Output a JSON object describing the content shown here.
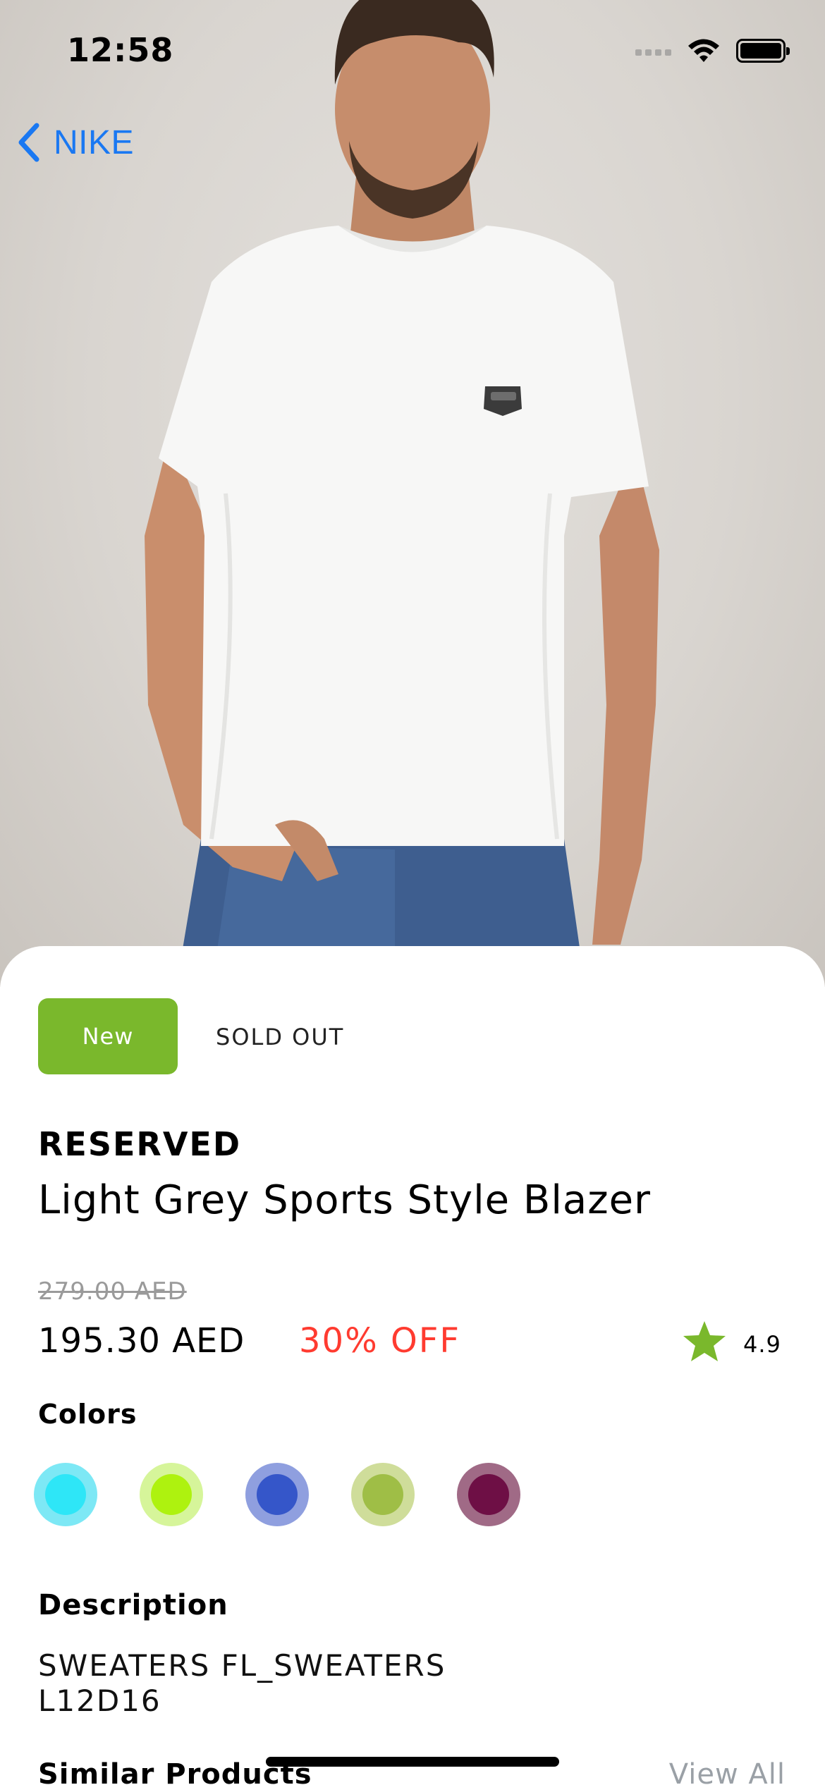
{
  "status_bar": {
    "time": "12:58"
  },
  "nav": {
    "back_label": "NIKE"
  },
  "product": {
    "badge": "New",
    "availability": "SOLD OUT",
    "brand": "RESERVED",
    "title": "Light Grey Sports Style Blazer",
    "original_price": "279.00 AED",
    "price": "195.30 AED",
    "discount": "30% OFF",
    "rating": "4.9"
  },
  "colors": {
    "label": "Colors",
    "swatches": [
      {
        "name": "cyan",
        "ring": "#7de8f5",
        "fill": "#2ee6f7"
      },
      {
        "name": "lime",
        "ring": "#d6f59a",
        "fill": "#aef20f"
      },
      {
        "name": "blue",
        "ring": "#8f9fdf",
        "fill": "#3556c9"
      },
      {
        "name": "olive",
        "ring": "#cfdd9a",
        "fill": "#9fbe46"
      },
      {
        "name": "plum",
        "ring": "#a06a86",
        "fill": "#6e0f45"
      }
    ]
  },
  "description": {
    "label": "Description",
    "text": "SWEATERS FL_SWEATERS L12D16"
  },
  "similar_products": {
    "label": "Similar Products",
    "view_all": "View All"
  },
  "theme": {
    "accent_green": "#7ab82c",
    "discount_red": "#ff3b30",
    "link_blue": "#1a78f2"
  }
}
